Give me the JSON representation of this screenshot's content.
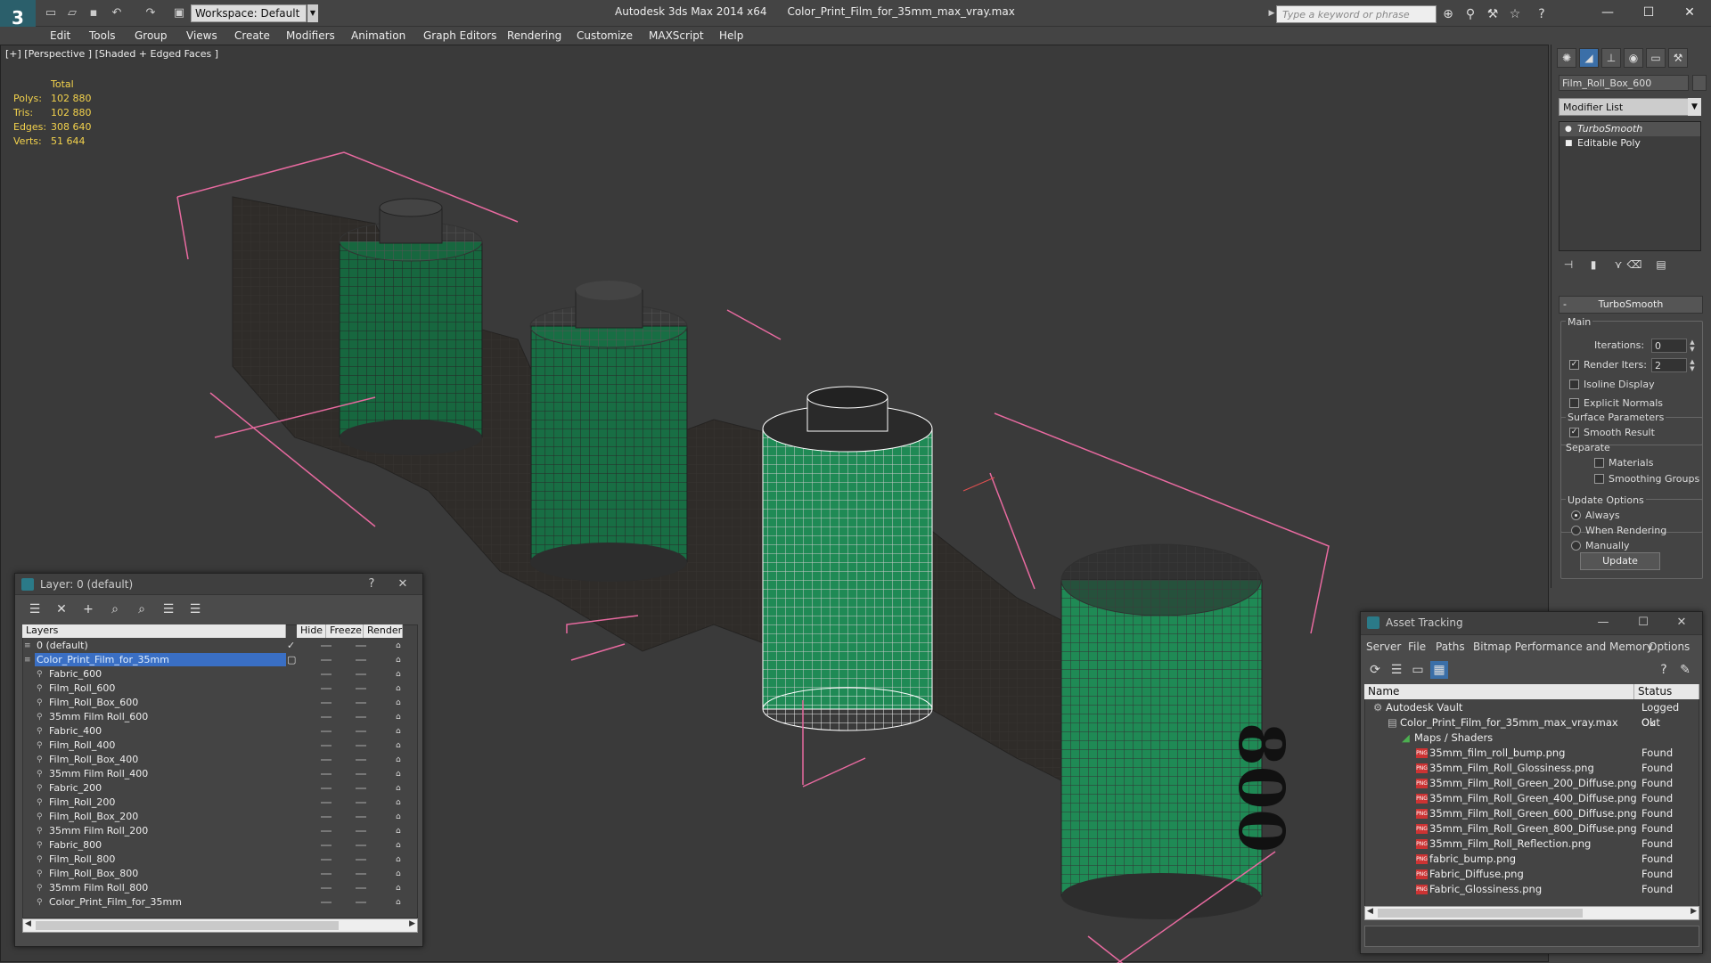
{
  "window": {
    "app_title": "Autodesk 3ds Max  2014 x64",
    "file_title": "Color_Print_Film_for_35mm_max_vray.max",
    "workspace": "Workspace: Default",
    "search_placeholder": "Type a keyword or phrase"
  },
  "menu": [
    "Edit",
    "Tools",
    "Group",
    "Views",
    "Create",
    "Modifiers",
    "Animation",
    "Graph Editors",
    "Rendering",
    "Customize",
    "MAXScript",
    "Help"
  ],
  "viewport": {
    "label": "[+] [Perspective ] [Shaded + Edged Faces ]",
    "stats_header": "Total",
    "stats": [
      {
        "label": "Polys:",
        "value": "102 880"
      },
      {
        "label": "Tris:",
        "value": "102 880"
      },
      {
        "label": "Edges:",
        "value": "308 640"
      },
      {
        "label": "Verts:",
        "value": "51 644"
      }
    ],
    "film_label": "800"
  },
  "command_panel": {
    "object_name": "Film_Roll_Box_600",
    "modifier_list": "Modifier List",
    "stack": [
      "TurboSmooth",
      "Editable Poly"
    ],
    "rollout_title": "TurboSmooth",
    "main_group": "Main",
    "iterations_label": "Iterations:",
    "iterations_value": "0",
    "render_iters_label": "Render Iters:",
    "render_iters_value": "2",
    "isoline": "Isoline Display",
    "explicit_normals": "Explicit Normals",
    "surface_group": "Surface Parameters",
    "smooth_result": "Smooth Result",
    "separate": "Separate",
    "materials": "Materials",
    "smoothing_groups": "Smoothing Groups",
    "update_group": "Update Options",
    "always": "Always",
    "when_rendering": "When Rendering",
    "manually": "Manually",
    "update_button": "Update"
  },
  "layer_panel": {
    "title": "Layer: 0 (default)",
    "help": "?",
    "columns": [
      "Layers",
      "Hide",
      "Freeze",
      "Render"
    ],
    "rows": [
      {
        "name": "0 (default)",
        "level": 1,
        "selected": false
      },
      {
        "name": "Color_Print_Film_for_35mm",
        "level": 1,
        "selected": true
      },
      {
        "name": "Fabric_600",
        "level": 2,
        "selected": false
      },
      {
        "name": "Film_Roll_600",
        "level": 2,
        "selected": false
      },
      {
        "name": "Film_Roll_Box_600",
        "level": 2,
        "selected": false
      },
      {
        "name": "35mm Film Roll_600",
        "level": 2,
        "selected": false
      },
      {
        "name": "Fabric_400",
        "level": 2,
        "selected": false
      },
      {
        "name": "Film_Roll_400",
        "level": 2,
        "selected": false
      },
      {
        "name": "Film_Roll_Box_400",
        "level": 2,
        "selected": false
      },
      {
        "name": "35mm Film Roll_400",
        "level": 2,
        "selected": false
      },
      {
        "name": "Fabric_200",
        "level": 2,
        "selected": false
      },
      {
        "name": "Film_Roll_200",
        "level": 2,
        "selected": false
      },
      {
        "name": "Film_Roll_Box_200",
        "level": 2,
        "selected": false
      },
      {
        "name": "35mm Film Roll_200",
        "level": 2,
        "selected": false
      },
      {
        "name": "Fabric_800",
        "level": 2,
        "selected": false
      },
      {
        "name": "Film_Roll_800",
        "level": 2,
        "selected": false
      },
      {
        "name": "Film_Roll_Box_800",
        "level": 2,
        "selected": false
      },
      {
        "name": "35mm Film Roll_800",
        "level": 2,
        "selected": false
      },
      {
        "name": "Color_Print_Film_for_35mm",
        "level": 2,
        "selected": false
      }
    ]
  },
  "asset_panel": {
    "title": "Asset Tracking",
    "menu": [
      "Server",
      "File",
      "Paths",
      "Bitmap Performance and Memory",
      "Options"
    ],
    "columns": [
      "Name",
      "Status"
    ],
    "rows": [
      {
        "name": "Autodesk Vault",
        "status": "Logged Out",
        "level": 0,
        "icon": "vault"
      },
      {
        "name": "Color_Print_Film_for_35mm_max_vray.max",
        "status": "Ok",
        "level": 1,
        "icon": "max"
      },
      {
        "name": "Maps / Shaders",
        "status": "",
        "level": 2,
        "icon": "maps"
      },
      {
        "name": "35mm_film_roll_bump.png",
        "status": "Found",
        "level": 3,
        "icon": "png"
      },
      {
        "name": "35mm_Film_Roll_Glossiness.png",
        "status": "Found",
        "level": 3,
        "icon": "png"
      },
      {
        "name": "35mm_Film_Roll_Green_200_Diffuse.png",
        "status": "Found",
        "level": 3,
        "icon": "png"
      },
      {
        "name": "35mm_Film_Roll_Green_400_Diffuse.png",
        "status": "Found",
        "level": 3,
        "icon": "png"
      },
      {
        "name": "35mm_Film_Roll_Green_600_Diffuse.png",
        "status": "Found",
        "level": 3,
        "icon": "png"
      },
      {
        "name": "35mm_Film_Roll_Green_800_Diffuse.png",
        "status": "Found",
        "level": 3,
        "icon": "png"
      },
      {
        "name": "35mm_Film_Roll_Reflection.png",
        "status": "Found",
        "level": 3,
        "icon": "png"
      },
      {
        "name": "fabric_bump.png",
        "status": "Found",
        "level": 3,
        "icon": "png"
      },
      {
        "name": "Fabric_Diffuse.png",
        "status": "Found",
        "level": 3,
        "icon": "png"
      },
      {
        "name": "Fabric_Glossiness.png",
        "status": "Found",
        "level": 3,
        "icon": "png"
      }
    ],
    "png_badge": "PNG"
  },
  "colors": {
    "selection": "#3a6fc4",
    "stats_text": "#f3d24c",
    "bounding_box": "#e86aa0",
    "film_green": "#1f8a55",
    "viewport_bg": "#3a3a3a"
  }
}
